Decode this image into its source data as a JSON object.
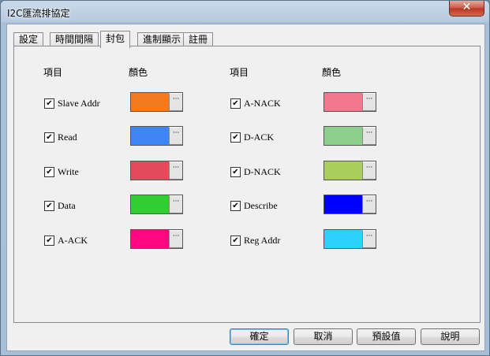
{
  "window": {
    "title": "I2C匯流排協定",
    "close_glyph": "✕"
  },
  "tabs": [
    {
      "label": "設定"
    },
    {
      "label": "時間間隔"
    },
    {
      "label": "封包"
    },
    {
      "label": "進制顯示"
    },
    {
      "label": "註冊"
    }
  ],
  "active_tab": "封包",
  "headers": {
    "item": "項目",
    "color": "顏色"
  },
  "left_items": [
    {
      "label": "Slave Addr",
      "checked": true,
      "color": "#f47a20"
    },
    {
      "label": "Read",
      "checked": true,
      "color": "#3f85f5"
    },
    {
      "label": "Write",
      "checked": true,
      "color": "#e54a5b"
    },
    {
      "label": "Data",
      "checked": true,
      "color": "#33cc33"
    },
    {
      "label": "A-ACK",
      "checked": true,
      "color": "#ff0780"
    }
  ],
  "right_items": [
    {
      "label": "A-NACK",
      "checked": true,
      "color": "#f3778d"
    },
    {
      "label": "D-ACK",
      "checked": true,
      "color": "#8dd08d"
    },
    {
      "label": "D-NACK",
      "checked": true,
      "color": "#abcd5e"
    },
    {
      "label": "Describe",
      "checked": true,
      "color": "#0000ff"
    },
    {
      "label": "Reg Addr",
      "checked": true,
      "color": "#2ed0ff"
    }
  ],
  "swatch_button_glyph": "···",
  "check_glyph": "✔",
  "buttons": {
    "ok": "確定",
    "cancel": "取消",
    "default": "預設值",
    "help": "說明"
  }
}
